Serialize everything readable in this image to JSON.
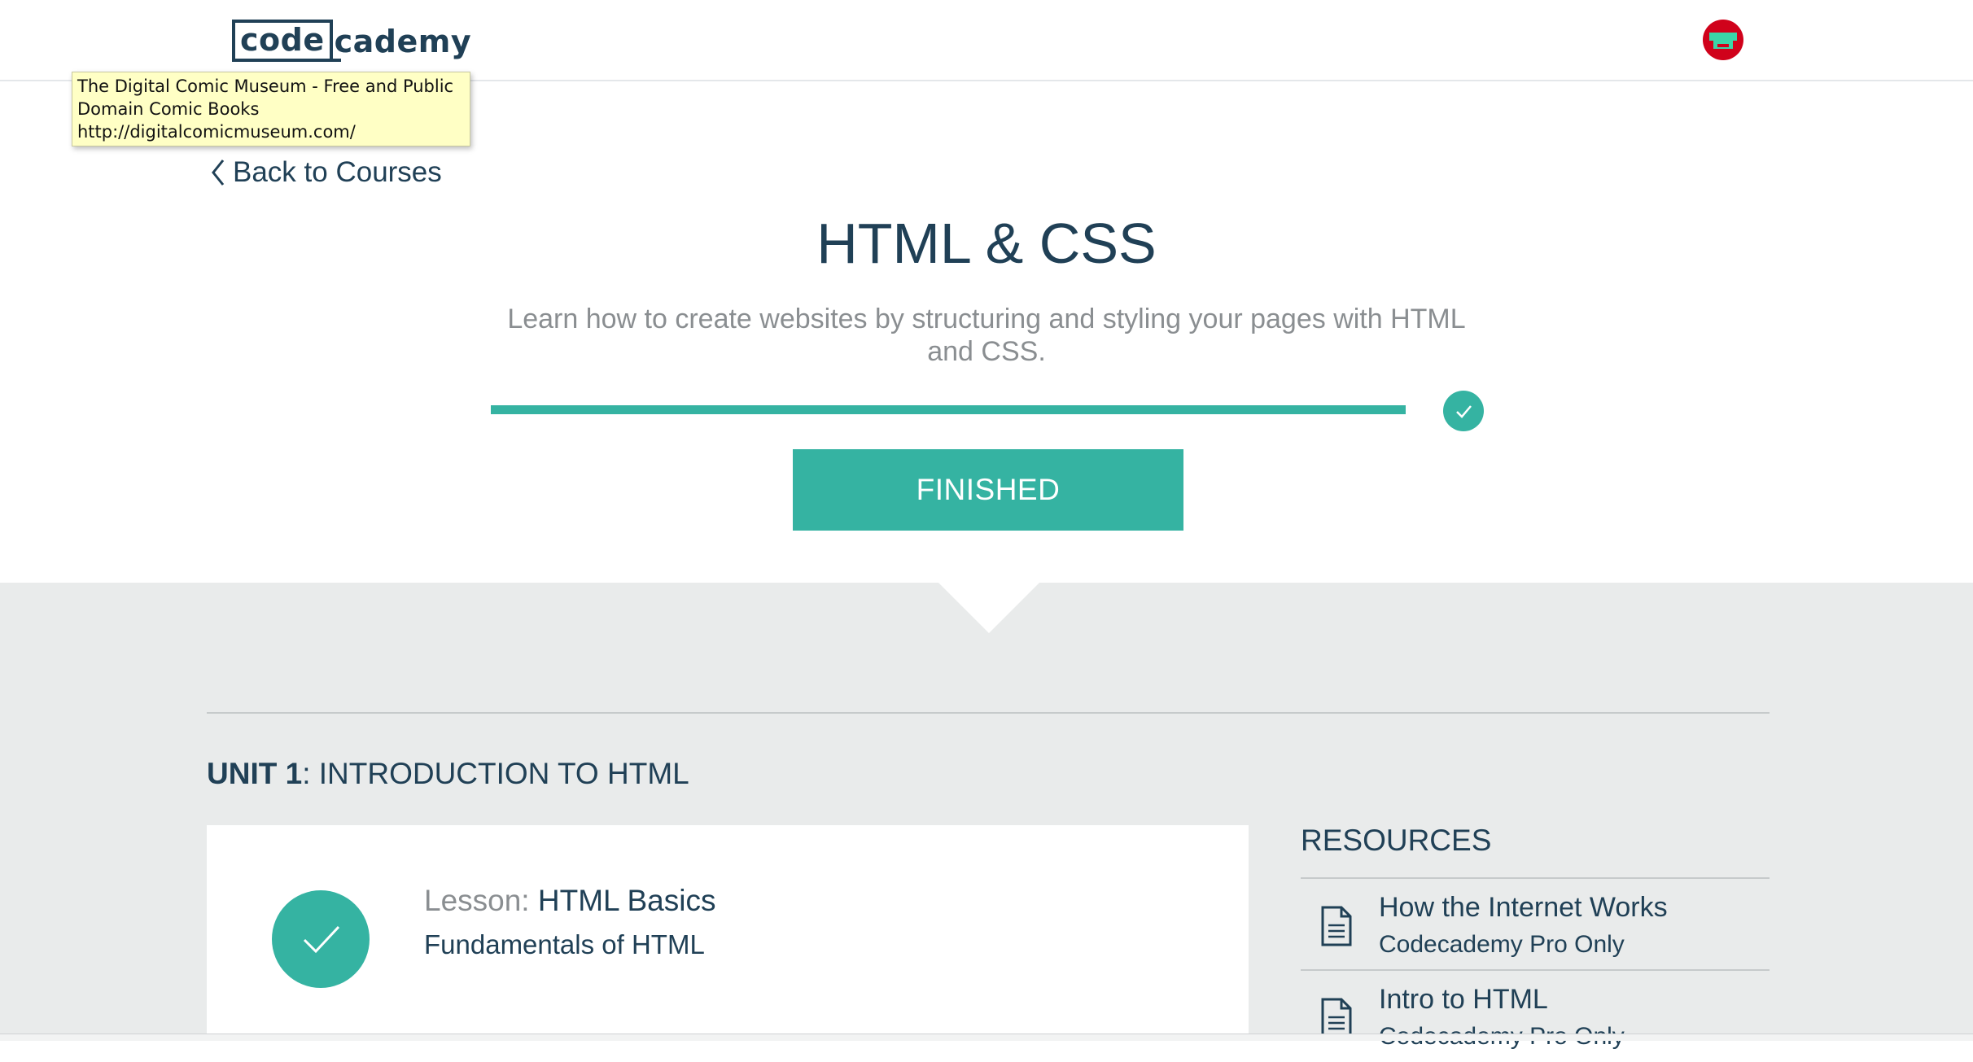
{
  "header": {
    "logo_box": "code",
    "logo_rest": "cademy"
  },
  "tooltip": {
    "line1": "The Digital Comic Museum - Free and Public",
    "line2": "Domain Comic Books",
    "line3": "http://digitalcomicmuseum.com/"
  },
  "nav": {
    "back_label": "Back to Courses"
  },
  "course": {
    "title": "HTML & CSS",
    "description": "Learn how to create websites by structuring and styling your pages with HTML and CSS.",
    "progress_percent": 100,
    "status_button": "FINISHED"
  },
  "unit": {
    "number_label": "UNIT 1",
    "name": ": INTRODUCTION TO HTML"
  },
  "lesson": {
    "prefix": "Lesson: ",
    "name": "HTML Basics",
    "subtitle": "Fundamentals of HTML"
  },
  "resources": {
    "title": "RESOURCES",
    "items": [
      {
        "name": "How the Internet Works",
        "note": "Codecademy Pro Only",
        "icon": "document-icon"
      },
      {
        "name": "Intro to HTML",
        "note": "Codecademy Pro Only",
        "icon": "document-icon"
      }
    ]
  },
  "colors": {
    "accent": "#35b3a2",
    "text_dark": "#204056",
    "text_muted": "#8a8e91",
    "gray_bg": "#e9ebeb",
    "avatar_red": "#d0021b"
  }
}
